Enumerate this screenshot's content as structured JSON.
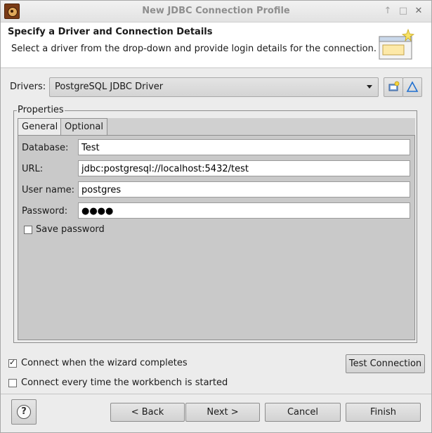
{
  "window": {
    "title": "New JDBC Connection Profile",
    "controls": [
      "↑",
      "□",
      "✕"
    ]
  },
  "banner": {
    "title": "Specify a Driver and Connection Details",
    "description": "Select a driver from the drop-down and provide login details for the connection."
  },
  "drivers": {
    "label": "Drivers:",
    "selected": "PostgreSQL JDBC Driver"
  },
  "properties": {
    "legend": "Properties",
    "tabs": [
      {
        "label": "General",
        "active": true
      },
      {
        "label": "Optional",
        "active": false
      }
    ],
    "fields": {
      "database": {
        "label": "Database:",
        "value": "Test"
      },
      "url": {
        "label": "URL:",
        "value": "jdbc:postgresql://localhost:5432/test"
      },
      "username": {
        "label": "User name:",
        "value": "postgres"
      },
      "password": {
        "label": "Password:",
        "value": "●●●●"
      }
    },
    "save_password": {
      "label": "Save password",
      "checked": false
    }
  },
  "options": {
    "connect_on_finish": {
      "label": "Connect when the wizard completes",
      "checked": true
    },
    "connect_on_startup": {
      "label": "Connect every time the workbench is started",
      "checked": false
    }
  },
  "buttons": {
    "test_connection": "Test Connection",
    "help": "?",
    "back": "< Back",
    "next": "Next >",
    "cancel": "Cancel",
    "finish": "Finish"
  },
  "colors": {
    "dialog_bg": "#ececec",
    "tab_panel_bg": "#c9c9c9",
    "accent_blue": "#1f6fd0"
  }
}
